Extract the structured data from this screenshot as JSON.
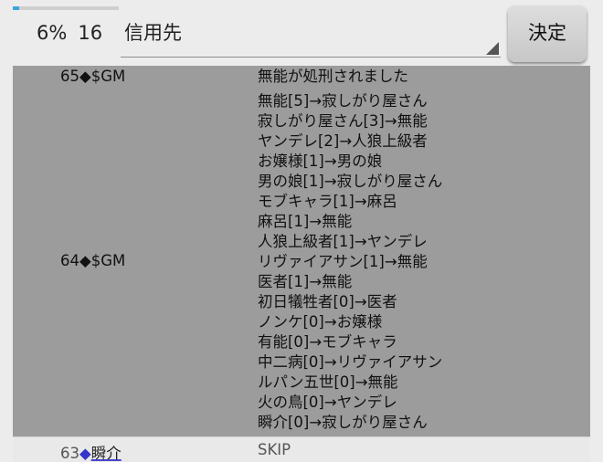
{
  "progress": {
    "percent": 6,
    "percent_label": "6%",
    "count": "16"
  },
  "target_select": {
    "value": "信用先"
  },
  "decide_button": {
    "label": "決定"
  },
  "log": [
    {
      "day": "65",
      "marker": "◆",
      "speaker": "$GM",
      "lines": [
        "無能が処刑されました"
      ]
    },
    {
      "day": "64",
      "marker": "◆",
      "speaker": "$GM",
      "lines": [
        "無能[5]→寂しがり屋さん",
        "寂しがり屋さん[3]→無能",
        "ヤンデレ[2]→人狼上級者",
        "お嬢様[1]→男の娘",
        "男の娘[1]→寂しがり屋さん",
        "モブキャラ[1]→麻呂",
        "麻呂[1]→無能",
        "人狼上級者[1]→ヤンデレ",
        "リヴァイアサン[1]→無能",
        "医者[1]→無能",
        "初日犠牲者[0]→医者",
        "ノンケ[0]→お嬢様",
        "有能[0]→モブキャラ",
        "中二病[0]→リヴァイアサン",
        "ルパン五世[0]→無能",
        "火の鳥[0]→ヤンデレ",
        "瞬介[0]→寂しがり屋さん"
      ]
    },
    {
      "day": "63",
      "marker": "◆",
      "speaker": "瞬介",
      "lines": [
        "SKIP"
      ]
    }
  ],
  "colors": {
    "accent": "#3aa6e0",
    "marker_blue": "#3535c8",
    "row_gray": "#9c9c9c"
  }
}
